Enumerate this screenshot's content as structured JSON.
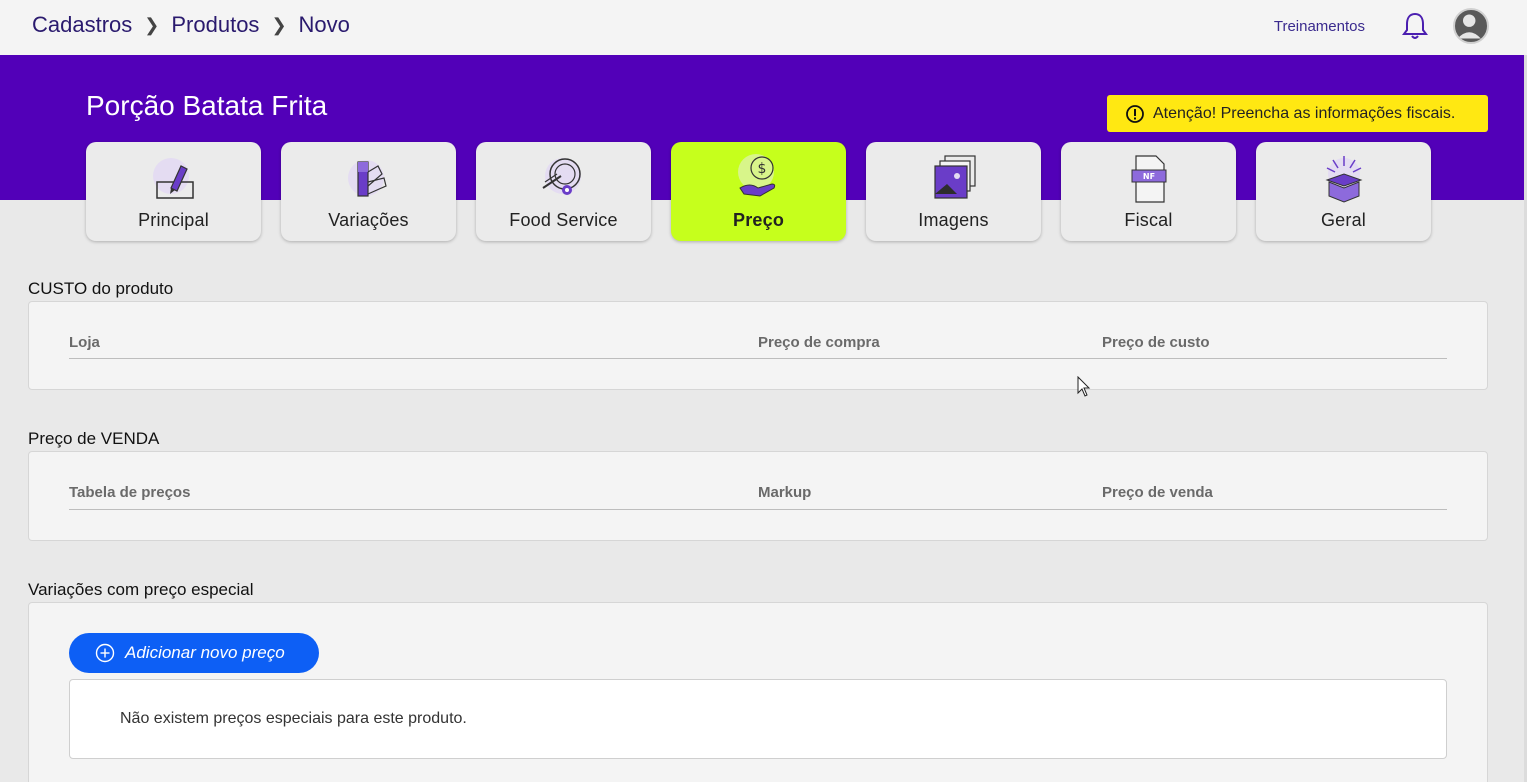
{
  "breadcrumb": {
    "items": [
      "Cadastros",
      "Produtos",
      "Novo"
    ]
  },
  "header": {
    "treinamentos": "Treinamentos"
  },
  "product": {
    "title": "Porção Batata Frita"
  },
  "alert": {
    "text": "Atenção! Preencha as informações fiscais."
  },
  "tabs": [
    {
      "label": "Principal",
      "icon": "pencil-icon"
    },
    {
      "label": "Variações",
      "icon": "color-swatch-icon"
    },
    {
      "label": "Food Service",
      "icon": "plate-cutlery-icon"
    },
    {
      "label": "Preço",
      "icon": "hand-dollar-icon",
      "active": true
    },
    {
      "label": "Imagens",
      "icon": "images-icon"
    },
    {
      "label": "Fiscal",
      "icon": "nf-document-icon"
    },
    {
      "label": "Geral",
      "icon": "open-box-icon"
    }
  ],
  "custo": {
    "title": "CUSTO do produto",
    "columns": [
      "Loja",
      "Preço de compra",
      "Preço de custo"
    ]
  },
  "venda": {
    "title": "Preço de VENDA",
    "columns": [
      "Tabela de preços",
      "Markup",
      "Preço de venda"
    ]
  },
  "especial": {
    "title": "Variações com preço especial",
    "add_button": "Adicionar novo preço",
    "empty_message": "Não existem preços especiais para este produto."
  },
  "colors": {
    "brand_purple": "#5200b8",
    "active_tab": "#c6ff1c",
    "alert_yellow": "#ffe812",
    "primary_button": "#0d5ff5"
  }
}
